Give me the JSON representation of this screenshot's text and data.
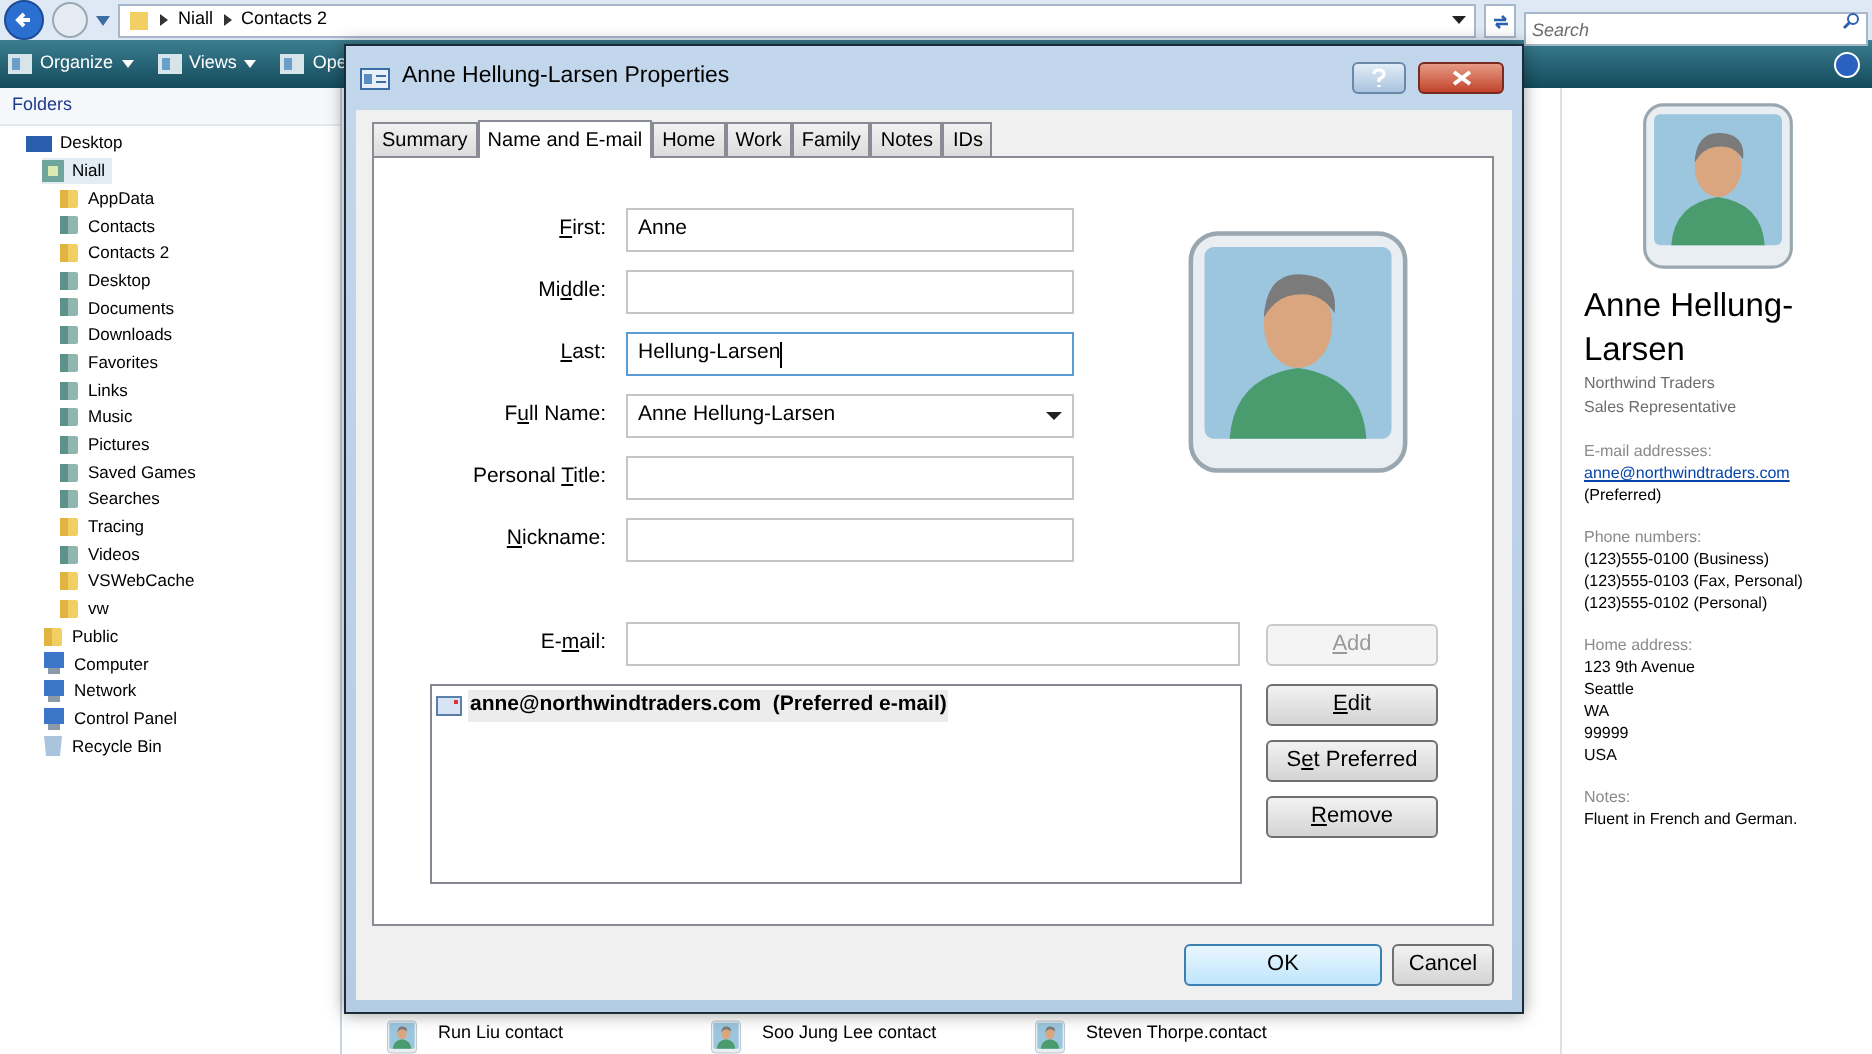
{
  "explorer": {
    "breadcrumb": [
      "Niall",
      "Contacts 2"
    ],
    "search": {
      "placeholder": "Search"
    },
    "toolbar": [
      {
        "label": "Organize",
        "dropdown": true
      },
      {
        "label": "Views",
        "dropdown": true
      },
      {
        "label": "Ope",
        "dropdown": false
      }
    ],
    "folders_header": "Folders",
    "tree": [
      {
        "label": "Desktop",
        "kind": "desktop",
        "selected": false,
        "children": [
          {
            "label": "Niall",
            "kind": "user",
            "selected": true,
            "children": [
              {
                "label": "AppData",
                "kind": "folder",
                "selected": false
              },
              {
                "label": "Contacts",
                "kind": "system",
                "selected": false
              },
              {
                "label": "Contacts 2",
                "kind": "folder",
                "selected": false
              },
              {
                "label": "Desktop",
                "kind": "system",
                "selected": false
              },
              {
                "label": "Documents",
                "kind": "system",
                "selected": false
              },
              {
                "label": "Downloads",
                "kind": "system",
                "selected": false
              },
              {
                "label": "Favorites",
                "kind": "system",
                "selected": false
              },
              {
                "label": "Links",
                "kind": "system",
                "selected": false
              },
              {
                "label": "Music",
                "kind": "system",
                "selected": false
              },
              {
                "label": "Pictures",
                "kind": "system",
                "selected": false
              },
              {
                "label": "Saved Games",
                "kind": "system",
                "selected": false
              },
              {
                "label": "Searches",
                "kind": "system",
                "selected": false
              },
              {
                "label": "Tracing",
                "kind": "folder",
                "selected": false
              },
              {
                "label": "Videos",
                "kind": "system",
                "selected": false
              },
              {
                "label": "VSWebCache",
                "kind": "folder",
                "selected": false
              },
              {
                "label": "vw",
                "kind": "folder",
                "selected": false
              }
            ]
          },
          {
            "label": "Public",
            "kind": "folder",
            "selected": false
          },
          {
            "label": "Computer",
            "kind": "computer",
            "selected": false
          },
          {
            "label": "Network",
            "kind": "computer",
            "selected": false
          },
          {
            "label": "Control Panel",
            "kind": "computer",
            "selected": false
          },
          {
            "label": "Recycle Bin",
            "kind": "bin",
            "selected": false
          }
        ]
      }
    ],
    "files": [
      {
        "name": "Run Liu contact"
      },
      {
        "name": "Soo Jung Lee contact"
      },
      {
        "name": "Steven Thorpe.contact"
      }
    ],
    "preview": {
      "name": "Anne Hellung-Larsen",
      "company": "Northwind Traders",
      "job_title": "Sales Representative",
      "sections": [
        {
          "heading": "E-mail addresses:",
          "lines": [
            {
              "text": "anne@northwindtraders.com",
              "kind": "link"
            },
            {
              "text": "(Preferred)",
              "kind": "text"
            }
          ]
        },
        {
          "heading": "Phone numbers:",
          "lines": [
            {
              "text": "(123)555-0100 (Business)",
              "kind": "text"
            },
            {
              "text": "(123)555-0103 (Fax, Personal)",
              "kind": "text"
            },
            {
              "text": "(123)555-0102 (Personal)",
              "kind": "text"
            }
          ]
        },
        {
          "heading": "Home address:",
          "lines": [
            {
              "text": "123 9th Avenue",
              "kind": "text"
            },
            {
              "text": "Seattle",
              "kind": "text"
            },
            {
              "text": "WA",
              "kind": "text"
            },
            {
              "text": "99999",
              "kind": "text"
            },
            {
              "text": "USA",
              "kind": "text"
            }
          ]
        },
        {
          "heading": "Notes:",
          "lines": [
            {
              "text": "Fluent in French and German.",
              "kind": "text"
            }
          ]
        }
      ]
    }
  },
  "dialog": {
    "title": "Anne Hellung-Larsen Properties",
    "tabs": [
      {
        "label": "Summary",
        "selected": false
      },
      {
        "label": "Name and E-mail",
        "selected": true
      },
      {
        "label": "Home",
        "selected": false
      },
      {
        "label": "Work",
        "selected": false
      },
      {
        "label": "Family",
        "selected": false
      },
      {
        "label": "Notes",
        "selected": false
      },
      {
        "label": "IDs",
        "selected": false
      }
    ],
    "fields": [
      {
        "label": {
          "key": "F",
          "post": "irst:"
        },
        "value": "Anne",
        "kind": "text",
        "focused": false
      },
      {
        "label": {
          "pre": "Mi",
          "key": "d",
          "post": "dle:"
        },
        "kind": "text",
        "focused": false
      },
      {
        "label": {
          "key": "L",
          "post": "ast:"
        },
        "value": "Hellung-Larsen",
        "kind": "text",
        "focused": true
      },
      {
        "label": {
          "pre": "F",
          "key": "u",
          "post": "ll Name:"
        },
        "value": "Anne Hellung-Larsen",
        "kind": "dropdown",
        "focused": false
      },
      {
        "label": {
          "pre": "Personal ",
          "key": "T",
          "post": "itle:"
        },
        "kind": "text",
        "focused": false
      },
      {
        "label": {
          "key": "N",
          "post": "ickname:"
        },
        "kind": "text",
        "focused": false
      }
    ],
    "email": {
      "label": {
        "pre": "E-",
        "key": "m",
        "post": "ail:"
      },
      "add_button": {
        "label": {
          "key": "A",
          "post": "dd"
        },
        "disabled": true
      }
    },
    "email_list": [
      {
        "text": "anne@northwindtraders.com  (Preferred e-mail)",
        "selected": true
      }
    ],
    "list_buttons": [
      {
        "label": {
          "key": "E",
          "post": "dit"
        },
        "disabled": false
      },
      {
        "label": {
          "pre": "S",
          "key": "e",
          "post": "t Preferred"
        },
        "disabled": false
      },
      {
        "label": {
          "key": "R",
          "post": "emove"
        },
        "disabled": false
      }
    ],
    "buttons": [
      {
        "label": "OK",
        "default": true
      },
      {
        "label": "Cancel",
        "default": false
      }
    ]
  }
}
